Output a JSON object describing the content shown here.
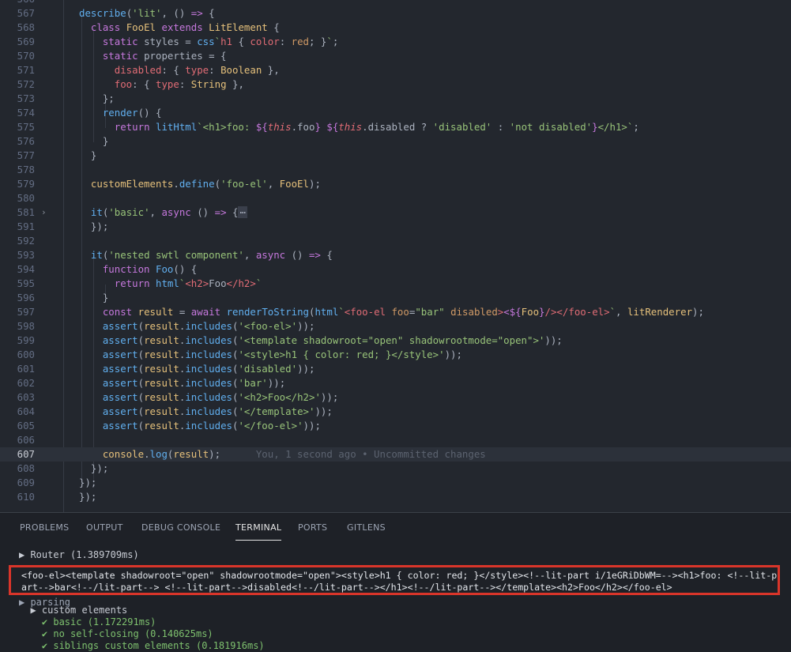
{
  "editor": {
    "lines": [
      {
        "n": "566",
        "cut": true,
        "segs": []
      },
      {
        "n": "567",
        "segs": [
          {
            "c": "fn",
            "t": "describe"
          },
          {
            "c": "pl",
            "t": "("
          },
          {
            "c": "str",
            "t": "'lit'"
          },
          {
            "c": "pl",
            "t": ", () "
          },
          {
            "c": "kw",
            "t": "=>"
          },
          {
            "c": "pl",
            "t": " {"
          }
        ]
      },
      {
        "n": "568",
        "segs": [
          {
            "c": "pl",
            "t": "  "
          },
          {
            "c": "kw",
            "t": "class"
          },
          {
            "c": "pl",
            "t": " "
          },
          {
            "c": "cls",
            "t": "FooEl"
          },
          {
            "c": "pl",
            "t": " "
          },
          {
            "c": "kw",
            "t": "extends"
          },
          {
            "c": "pl",
            "t": " "
          },
          {
            "c": "cls",
            "t": "LitElement"
          },
          {
            "c": "pl",
            "t": " {"
          }
        ]
      },
      {
        "n": "569",
        "segs": [
          {
            "c": "pl",
            "t": "    "
          },
          {
            "c": "kw",
            "t": "static"
          },
          {
            "c": "pl",
            "t": " styles = "
          },
          {
            "c": "fn",
            "t": "css"
          },
          {
            "c": "str",
            "t": "`"
          },
          {
            "c": "prop",
            "t": "h1"
          },
          {
            "c": "pl",
            "t": " { "
          },
          {
            "c": "prop",
            "t": "color"
          },
          {
            "c": "pl",
            "t": ": "
          },
          {
            "c": "num",
            "t": "red"
          },
          {
            "c": "pl",
            "t": "; }"
          },
          {
            "c": "str",
            "t": "`"
          },
          {
            "c": "pl",
            "t": ";"
          }
        ]
      },
      {
        "n": "570",
        "segs": [
          {
            "c": "pl",
            "t": "    "
          },
          {
            "c": "kw",
            "t": "static"
          },
          {
            "c": "pl",
            "t": " properties = {"
          }
        ]
      },
      {
        "n": "571",
        "segs": [
          {
            "c": "pl",
            "t": "      "
          },
          {
            "c": "prop",
            "t": "disabled"
          },
          {
            "c": "pl",
            "t": ": { "
          },
          {
            "c": "prop",
            "t": "type"
          },
          {
            "c": "pl",
            "t": ": "
          },
          {
            "c": "cls",
            "t": "Boolean"
          },
          {
            "c": "pl",
            "t": " },"
          }
        ]
      },
      {
        "n": "572",
        "segs": [
          {
            "c": "pl",
            "t": "      "
          },
          {
            "c": "prop",
            "t": "foo"
          },
          {
            "c": "pl",
            "t": ": { "
          },
          {
            "c": "prop",
            "t": "type"
          },
          {
            "c": "pl",
            "t": ": "
          },
          {
            "c": "cls",
            "t": "String"
          },
          {
            "c": "pl",
            "t": " },"
          }
        ]
      },
      {
        "n": "573",
        "segs": [
          {
            "c": "pl",
            "t": "    };"
          }
        ]
      },
      {
        "n": "574",
        "segs": [
          {
            "c": "pl",
            "t": "    "
          },
          {
            "c": "fn",
            "t": "render"
          },
          {
            "c": "pl",
            "t": "() {"
          }
        ]
      },
      {
        "n": "575",
        "segs": [
          {
            "c": "pl",
            "t": "      "
          },
          {
            "c": "kw",
            "t": "return"
          },
          {
            "c": "pl",
            "t": " "
          },
          {
            "c": "fn",
            "t": "litHtml"
          },
          {
            "c": "str",
            "t": "`<h1>foo: "
          },
          {
            "c": "kw",
            "t": "${"
          },
          {
            "c": "this",
            "t": "this"
          },
          {
            "c": "pl",
            "t": ".foo"
          },
          {
            "c": "kw",
            "t": "}"
          },
          {
            "c": "str",
            "t": " "
          },
          {
            "c": "kw",
            "t": "${"
          },
          {
            "c": "this",
            "t": "this"
          },
          {
            "c": "pl",
            "t": ".disabled ? "
          },
          {
            "c": "str",
            "t": "'disabled'"
          },
          {
            "c": "pl",
            "t": " : "
          },
          {
            "c": "str",
            "t": "'not disabled'"
          },
          {
            "c": "kw",
            "t": "}"
          },
          {
            "c": "str",
            "t": "</h1>`"
          },
          {
            "c": "pl",
            "t": ";"
          }
        ]
      },
      {
        "n": "576",
        "segs": [
          {
            "c": "pl",
            "t": "    }"
          }
        ]
      },
      {
        "n": "577",
        "segs": [
          {
            "c": "pl",
            "t": "  }"
          }
        ]
      },
      {
        "n": "578",
        "segs": []
      },
      {
        "n": "579",
        "segs": [
          {
            "c": "pl",
            "t": "  "
          },
          {
            "c": "cls",
            "t": "customElements"
          },
          {
            "c": "pl",
            "t": "."
          },
          {
            "c": "fn",
            "t": "define"
          },
          {
            "c": "pl",
            "t": "("
          },
          {
            "c": "str",
            "t": "'foo-el'"
          },
          {
            "c": "pl",
            "t": ", "
          },
          {
            "c": "cls",
            "t": "FooEl"
          },
          {
            "c": "pl",
            "t": ");"
          }
        ]
      },
      {
        "n": "580",
        "segs": []
      },
      {
        "n": "581",
        "fold": true,
        "segs": [
          {
            "c": "pl",
            "t": "  "
          },
          {
            "c": "fn",
            "t": "it"
          },
          {
            "c": "pl",
            "t": "("
          },
          {
            "c": "str",
            "t": "'basic'"
          },
          {
            "c": "pl",
            "t": ", "
          },
          {
            "c": "kw",
            "t": "async"
          },
          {
            "c": "pl",
            "t": " () "
          },
          {
            "c": "kw",
            "t": "=>"
          },
          {
            "c": "pl",
            "t": " {"
          },
          {
            "c": "ell",
            "t": "⋯"
          }
        ]
      },
      {
        "n": "591",
        "segs": [
          {
            "c": "pl",
            "t": "  });"
          }
        ]
      },
      {
        "n": "592",
        "segs": []
      },
      {
        "n": "593",
        "segs": [
          {
            "c": "pl",
            "t": "  "
          },
          {
            "c": "fn",
            "t": "it"
          },
          {
            "c": "pl",
            "t": "("
          },
          {
            "c": "str",
            "t": "'nested swtl component'"
          },
          {
            "c": "pl",
            "t": ", "
          },
          {
            "c": "kw",
            "t": "async"
          },
          {
            "c": "pl",
            "t": " () "
          },
          {
            "c": "kw",
            "t": "=>"
          },
          {
            "c": "pl",
            "t": " {"
          }
        ]
      },
      {
        "n": "594",
        "segs": [
          {
            "c": "pl",
            "t": "    "
          },
          {
            "c": "kw",
            "t": "function"
          },
          {
            "c": "pl",
            "t": " "
          },
          {
            "c": "fn",
            "t": "Foo"
          },
          {
            "c": "pl",
            "t": "() {"
          }
        ]
      },
      {
        "n": "595",
        "segs": [
          {
            "c": "pl",
            "t": "      "
          },
          {
            "c": "kw",
            "t": "return"
          },
          {
            "c": "pl",
            "t": " "
          },
          {
            "c": "fn",
            "t": "html"
          },
          {
            "c": "str",
            "t": "`"
          },
          {
            "c": "prop",
            "t": "<h2>"
          },
          {
            "c": "pl",
            "t": "Foo"
          },
          {
            "c": "prop",
            "t": "</h2>"
          },
          {
            "c": "str",
            "t": "`"
          }
        ]
      },
      {
        "n": "596",
        "segs": [
          {
            "c": "pl",
            "t": "    }"
          }
        ]
      },
      {
        "n": "597",
        "segs": [
          {
            "c": "pl",
            "t": "    "
          },
          {
            "c": "kw",
            "t": "const"
          },
          {
            "c": "pl",
            "t": " "
          },
          {
            "c": "cls",
            "t": "result"
          },
          {
            "c": "pl",
            "t": " = "
          },
          {
            "c": "kw",
            "t": "await"
          },
          {
            "c": "pl",
            "t": " "
          },
          {
            "c": "fn",
            "t": "renderToString"
          },
          {
            "c": "pl",
            "t": "("
          },
          {
            "c": "fn",
            "t": "html"
          },
          {
            "c": "str",
            "t": "`"
          },
          {
            "c": "prop",
            "t": "<foo-el"
          },
          {
            "c": "pl",
            "t": " "
          },
          {
            "c": "num",
            "t": "foo"
          },
          {
            "c": "pl",
            "t": "="
          },
          {
            "c": "str",
            "t": "\"bar\""
          },
          {
            "c": "pl",
            "t": " "
          },
          {
            "c": "num",
            "t": "disabled"
          },
          {
            "c": "prop",
            "t": ">"
          },
          {
            "c": "kw",
            "t": "<${"
          },
          {
            "c": "cls",
            "t": "Foo"
          },
          {
            "c": "kw",
            "t": "}"
          },
          {
            "c": "prop",
            "t": "/></foo-el>"
          },
          {
            "c": "str",
            "t": "`"
          },
          {
            "c": "pl",
            "t": ", "
          },
          {
            "c": "cls",
            "t": "litRenderer"
          },
          {
            "c": "pl",
            "t": ");"
          }
        ]
      },
      {
        "n": "598",
        "segs": [
          {
            "c": "pl",
            "t": "    "
          },
          {
            "c": "fn",
            "t": "assert"
          },
          {
            "c": "pl",
            "t": "("
          },
          {
            "c": "cls",
            "t": "result"
          },
          {
            "c": "pl",
            "t": "."
          },
          {
            "c": "fn",
            "t": "includes"
          },
          {
            "c": "pl",
            "t": "("
          },
          {
            "c": "str",
            "t": "'<foo-el>'"
          },
          {
            "c": "pl",
            "t": "));"
          }
        ]
      },
      {
        "n": "599",
        "segs": [
          {
            "c": "pl",
            "t": "    "
          },
          {
            "c": "fn",
            "t": "assert"
          },
          {
            "c": "pl",
            "t": "("
          },
          {
            "c": "cls",
            "t": "result"
          },
          {
            "c": "pl",
            "t": "."
          },
          {
            "c": "fn",
            "t": "includes"
          },
          {
            "c": "pl",
            "t": "("
          },
          {
            "c": "str",
            "t": "'<template shadowroot=\"open\" shadowrootmode=\"open\">'"
          },
          {
            "c": "pl",
            "t": "));"
          }
        ]
      },
      {
        "n": "600",
        "segs": [
          {
            "c": "pl",
            "t": "    "
          },
          {
            "c": "fn",
            "t": "assert"
          },
          {
            "c": "pl",
            "t": "("
          },
          {
            "c": "cls",
            "t": "result"
          },
          {
            "c": "pl",
            "t": "."
          },
          {
            "c": "fn",
            "t": "includes"
          },
          {
            "c": "pl",
            "t": "("
          },
          {
            "c": "str",
            "t": "'<style>h1 { color: red; }</style>'"
          },
          {
            "c": "pl",
            "t": "));"
          }
        ]
      },
      {
        "n": "601",
        "segs": [
          {
            "c": "pl",
            "t": "    "
          },
          {
            "c": "fn",
            "t": "assert"
          },
          {
            "c": "pl",
            "t": "("
          },
          {
            "c": "cls",
            "t": "result"
          },
          {
            "c": "pl",
            "t": "."
          },
          {
            "c": "fn",
            "t": "includes"
          },
          {
            "c": "pl",
            "t": "("
          },
          {
            "c": "str",
            "t": "'disabled'"
          },
          {
            "c": "pl",
            "t": "));"
          }
        ]
      },
      {
        "n": "602",
        "segs": [
          {
            "c": "pl",
            "t": "    "
          },
          {
            "c": "fn",
            "t": "assert"
          },
          {
            "c": "pl",
            "t": "("
          },
          {
            "c": "cls",
            "t": "result"
          },
          {
            "c": "pl",
            "t": "."
          },
          {
            "c": "fn",
            "t": "includes"
          },
          {
            "c": "pl",
            "t": "("
          },
          {
            "c": "str",
            "t": "'bar'"
          },
          {
            "c": "pl",
            "t": "));"
          }
        ]
      },
      {
        "n": "603",
        "segs": [
          {
            "c": "pl",
            "t": "    "
          },
          {
            "c": "fn",
            "t": "assert"
          },
          {
            "c": "pl",
            "t": "("
          },
          {
            "c": "cls",
            "t": "result"
          },
          {
            "c": "pl",
            "t": "."
          },
          {
            "c": "fn",
            "t": "includes"
          },
          {
            "c": "pl",
            "t": "("
          },
          {
            "c": "str",
            "t": "'<h2>Foo</h2>'"
          },
          {
            "c": "pl",
            "t": "));"
          }
        ]
      },
      {
        "n": "604",
        "segs": [
          {
            "c": "pl",
            "t": "    "
          },
          {
            "c": "fn",
            "t": "assert"
          },
          {
            "c": "pl",
            "t": "("
          },
          {
            "c": "cls",
            "t": "result"
          },
          {
            "c": "pl",
            "t": "."
          },
          {
            "c": "fn",
            "t": "includes"
          },
          {
            "c": "pl",
            "t": "("
          },
          {
            "c": "str",
            "t": "'</template>'"
          },
          {
            "c": "pl",
            "t": "));"
          }
        ]
      },
      {
        "n": "605",
        "segs": [
          {
            "c": "pl",
            "t": "    "
          },
          {
            "c": "fn",
            "t": "assert"
          },
          {
            "c": "pl",
            "t": "("
          },
          {
            "c": "cls",
            "t": "result"
          },
          {
            "c": "pl",
            "t": "."
          },
          {
            "c": "fn",
            "t": "includes"
          },
          {
            "c": "pl",
            "t": "("
          },
          {
            "c": "str",
            "t": "'</foo-el>'"
          },
          {
            "c": "pl",
            "t": "));"
          }
        ]
      },
      {
        "n": "606",
        "segs": []
      },
      {
        "n": "607",
        "current": true,
        "segs": [
          {
            "c": "pl",
            "t": "    "
          },
          {
            "c": "cls",
            "t": "console"
          },
          {
            "c": "pl",
            "t": "."
          },
          {
            "c": "fn",
            "t": "log"
          },
          {
            "c": "pl",
            "t": "("
          },
          {
            "c": "cls",
            "t": "result"
          },
          {
            "c": "pl",
            "t": ");"
          },
          {
            "c": "blame",
            "t": "      You, 1 second ago • Uncommitted changes"
          }
        ]
      },
      {
        "n": "608",
        "segs": [
          {
            "c": "pl",
            "t": "  });"
          }
        ]
      },
      {
        "n": "609",
        "segs": [
          {
            "c": "pl",
            "t": "});"
          }
        ]
      },
      {
        "n": "610",
        "segs": [
          {
            "c": "pl",
            "t": "});"
          }
        ]
      }
    ]
  },
  "panel": {
    "tabs": [
      "PROBLEMS",
      "OUTPUT",
      "DEBUG CONSOLE",
      "TERMINAL",
      "PORTS",
      "GITLENS"
    ],
    "active_tab": "TERMINAL"
  },
  "terminal": {
    "router_line": "▶ Router (1.389709ms)",
    "highlighted_output": "<foo-el><template shadowroot=\"open\" shadowrootmode=\"open\"><style>h1 { color: red; }</style><!--lit-part i/1eGRiDbWM=--><h1>foo: <!--lit-part-->bar<!--/lit-part--> <!--lit-part-->disabled<!--/lit-part--></h1><!--/lit-part--></template><h2>Foo</h2></foo-el>",
    "parsing_line": "▶ parsing",
    "custom_elements_line": "  ▶ custom elements",
    "results": [
      "    ✔ basic (1.172291ms)",
      "    ✔ no self-closing (0.140625ms)",
      "    ✔ siblings custom elements (0.181916ms)"
    ],
    "colors": {
      "highlight_border": "#d9352a",
      "pass": "#7ec16e"
    }
  }
}
